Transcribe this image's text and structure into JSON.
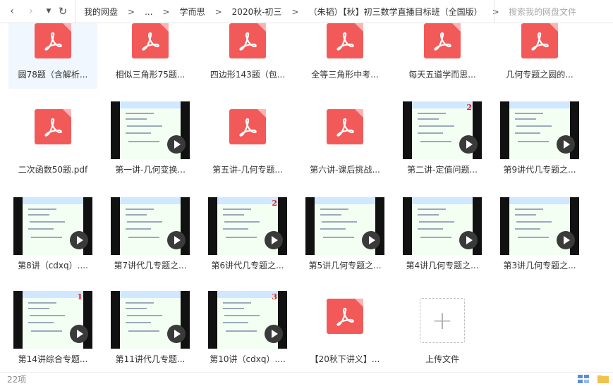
{
  "toolbar": {
    "back_icon": "chevron-left",
    "forward_icon": "chevron-right",
    "dropdown_icon": "caret-down",
    "refresh_icon": "refresh",
    "breadcrumbs": [
      "我的网盘",
      "...",
      "学而思",
      "2020秋-初三",
      "（朱韬）【秋】初三数学直播目标班（全国版）"
    ],
    "search_placeholder": "搜索我的网盘文件"
  },
  "files": [
    {
      "name": "圆78题（含解析...",
      "type": "pdf",
      "selected": true
    },
    {
      "name": "相似三角形75题...",
      "type": "pdf"
    },
    {
      "name": "四边形143题（包...",
      "type": "pdf"
    },
    {
      "name": "全等三角形中考...",
      "type": "pdf"
    },
    {
      "name": "每天五道学而思...",
      "type": "pdf"
    },
    {
      "name": "几何专题之圆的...",
      "type": "pdf"
    },
    {
      "name": "二次函数50题.pdf",
      "type": "pdf"
    },
    {
      "name": "第一讲-几何变换...",
      "type": "video",
      "page_no": ""
    },
    {
      "name": "第五讲-几何专题...",
      "type": "pdf"
    },
    {
      "name": "第六讲-课后挑战...",
      "type": "pdf"
    },
    {
      "name": "第二讲-定值问题...",
      "type": "video",
      "page_no": "2"
    },
    {
      "name": "第9讲代几专题之...",
      "type": "video",
      "page_no": ""
    },
    {
      "name": "第8讲（cdxq）....",
      "type": "video",
      "page_no": ""
    },
    {
      "name": "第7讲代几专题之...",
      "type": "video",
      "page_no": ""
    },
    {
      "name": "第6讲代几专题之...",
      "type": "video",
      "page_no": "2"
    },
    {
      "name": "第5讲几何专题之...",
      "type": "video",
      "page_no": ""
    },
    {
      "name": "第4讲几何专题之...",
      "type": "video",
      "page_no": ""
    },
    {
      "name": "第3讲几何专题之...",
      "type": "video",
      "page_no": ""
    },
    {
      "name": "第14讲综合专题...",
      "type": "video",
      "page_no": "1"
    },
    {
      "name": "第11讲代几专题...",
      "type": "video",
      "page_no": ""
    },
    {
      "name": "第10讲（cdxq）....",
      "type": "video",
      "page_no": "3"
    },
    {
      "name": "【20秋下讲义】...",
      "type": "pdf"
    }
  ],
  "upload": {
    "label": "上传文件",
    "icon": "plus"
  },
  "status": {
    "count": "22项"
  }
}
